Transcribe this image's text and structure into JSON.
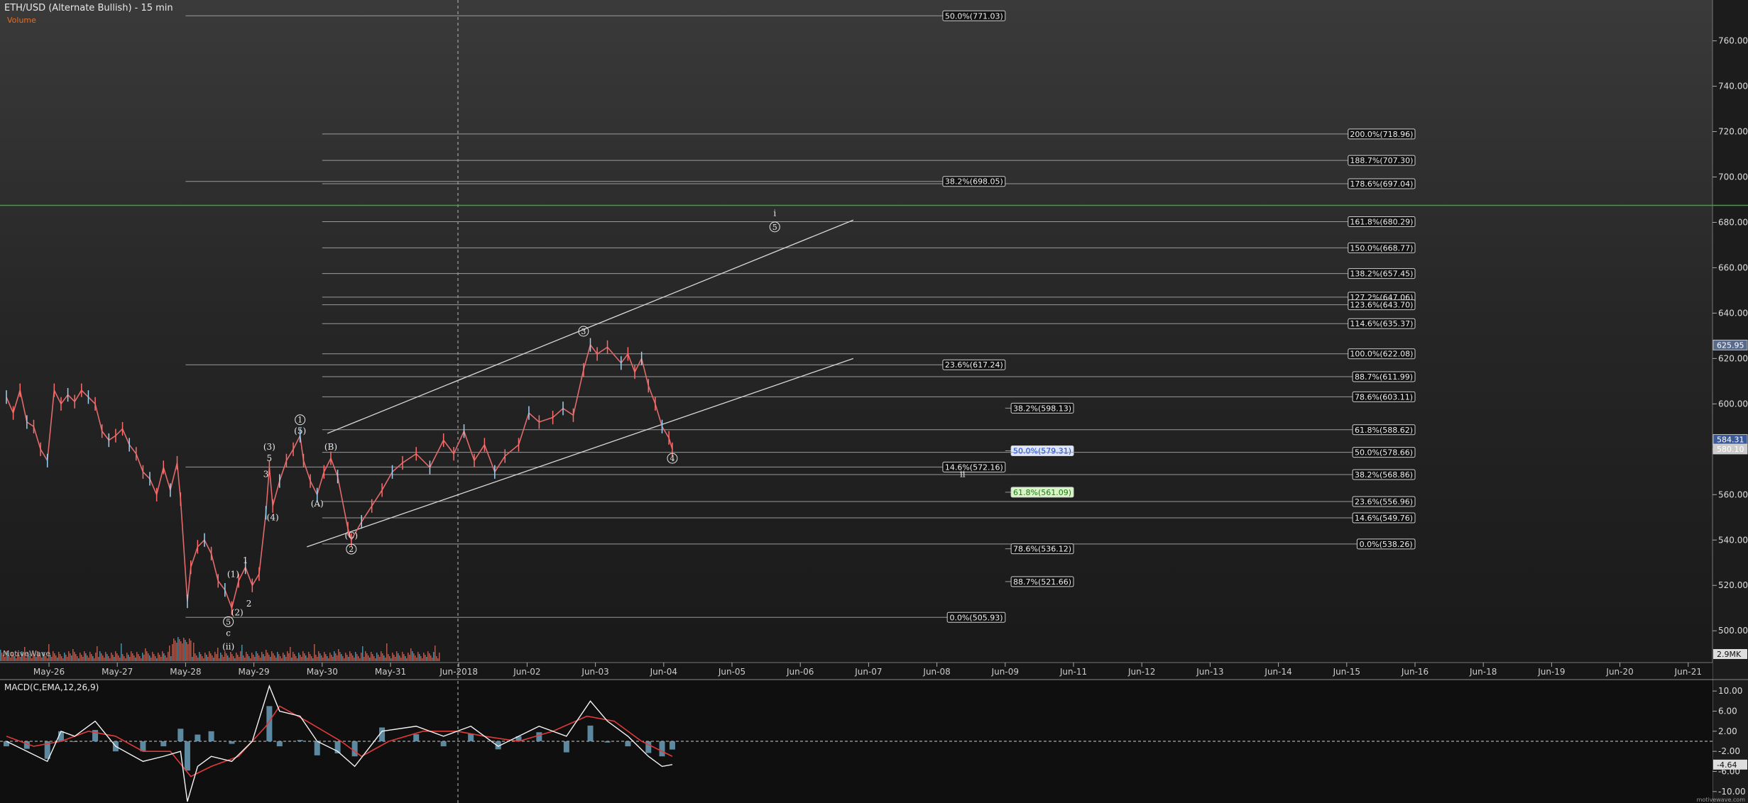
{
  "title": "ETH/USD (Alternate Bullish) - 15 min",
  "subtitle": "Volume",
  "watermark": "MotiveWave",
  "footer": "motivewave.com",
  "macd_label": "MACD(C,EMA,12,26,9)",
  "chart_data": {
    "type": "line",
    "price_axis": {
      "range": [
        486,
        778
      ],
      "ticks": [
        "760.00",
        "740.00",
        "720.00",
        "700.00",
        "680.00",
        "660.00",
        "640.00",
        "620.00",
        "600.00",
        "580.00",
        "560.00",
        "540.00",
        "520.00",
        "500.00"
      ]
    },
    "price_badges": [
      {
        "value": 625.95,
        "label": "625.95",
        "color": "#5a6a8a"
      },
      {
        "value": 584.31,
        "label": "584.31",
        "color": "#3a5a9a"
      },
      {
        "value": 580.1,
        "label": "580.10",
        "color": "#cccccc"
      }
    ],
    "volume_badge": "2.9MK",
    "date_axis": [
      "May-26",
      "May-27",
      "May-28",
      "May-29",
      "May-30",
      "May-31",
      "Jun-2018",
      "Jun-02",
      "Jun-03",
      "Jun-04",
      "Jun-05",
      "Jun-06",
      "Jun-07",
      "Jun-08",
      "Jun-09",
      "Jun-11",
      "Jun-12",
      "Jun-13",
      "Jun-14",
      "Jun-15",
      "Jun-16",
      "Jun-18",
      "Jun-19",
      "Jun-20",
      "Jun-21"
    ],
    "horizontal_line": {
      "value": 687.5,
      "color": "#2fae2f"
    },
    "fib_levels": [
      {
        "label": "50.0%(771.03)",
        "value": 771.03,
        "start_date": "May-28",
        "end_date": "Jun-09",
        "style": "plain"
      },
      {
        "label": "200.0%(718.96)",
        "value": 718.96,
        "start_date": "May-30",
        "end_date": "Jun-16",
        "style": "plain"
      },
      {
        "label": "188.7%(707.30)",
        "value": 707.3,
        "start_date": "May-30",
        "end_date": "Jun-16",
        "style": "plain"
      },
      {
        "label": "178.6%(697.04)",
        "value": 697.04,
        "start_date": "May-30",
        "end_date": "Jun-16",
        "style": "plain"
      },
      {
        "label": "38.2%(698.05)",
        "value": 698.05,
        "start_date": "May-28",
        "end_date": "Jun-09",
        "style": "plain"
      },
      {
        "label": "161.8%(680.29)",
        "value": 680.29,
        "start_date": "May-30",
        "end_date": "Jun-16",
        "style": "plain"
      },
      {
        "label": "150.0%(668.77)",
        "value": 668.77,
        "start_date": "May-30",
        "end_date": "Jun-16",
        "style": "plain"
      },
      {
        "label": "138.2%(657.45)",
        "value": 657.45,
        "start_date": "May-30",
        "end_date": "Jun-16",
        "style": "plain"
      },
      {
        "label": "127.2%(647.06)",
        "value": 647.06,
        "start_date": "May-30",
        "end_date": "Jun-16",
        "style": "plain"
      },
      {
        "label": "123.6%(643.70)",
        "value": 643.7,
        "start_date": "May-30",
        "end_date": "Jun-16",
        "style": "plain"
      },
      {
        "label": "114.6%(635.37)",
        "value": 635.37,
        "start_date": "May-30",
        "end_date": "Jun-16",
        "style": "plain"
      },
      {
        "label": "100.0%(622.08)",
        "value": 622.08,
        "start_date": "May-30",
        "end_date": "Jun-16",
        "style": "plain"
      },
      {
        "label": "23.6%(617.24)",
        "value": 617.24,
        "start_date": "May-28",
        "end_date": "Jun-09",
        "style": "plain"
      },
      {
        "label": "88.7%(611.99)",
        "value": 611.99,
        "start_date": "May-30",
        "end_date": "Jun-16",
        "style": "plain"
      },
      {
        "label": "78.6%(603.11)",
        "value": 603.11,
        "start_date": "May-30",
        "end_date": "Jun-16",
        "style": "plain"
      },
      {
        "label": "38.2%(598.13)",
        "value": 598.13,
        "start_date": "Jun-09",
        "end_date": "Jun-11",
        "style": "plain"
      },
      {
        "label": "61.8%(588.62)",
        "value": 588.62,
        "start_date": "May-30",
        "end_date": "Jun-16",
        "style": "plain"
      },
      {
        "label": "50.0%(579.31)",
        "value": 579.31,
        "start_date": "Jun-09",
        "end_date": "Jun-11",
        "style": "blue"
      },
      {
        "label": "50.0%(578.66)",
        "value": 578.66,
        "start_date": "May-30",
        "end_date": "Jun-16",
        "style": "plain"
      },
      {
        "label": "14.6%(572.16)",
        "value": 572.16,
        "start_date": "May-28",
        "end_date": "Jun-09",
        "style": "plain"
      },
      {
        "label": "38.2%(568.86)",
        "value": 568.86,
        "start_date": "May-30",
        "end_date": "Jun-16",
        "style": "plain"
      },
      {
        "label": "61.8%(561.09)",
        "value": 561.09,
        "start_date": "Jun-09",
        "end_date": "Jun-11",
        "style": "green"
      },
      {
        "label": "23.6%(556.96)",
        "value": 556.96,
        "start_date": "May-30",
        "end_date": "Jun-16",
        "style": "plain"
      },
      {
        "label": "14.6%(549.76)",
        "value": 549.76,
        "start_date": "May-30",
        "end_date": "Jun-16",
        "style": "plain"
      },
      {
        "label": "0.0%(538.26)",
        "value": 538.26,
        "start_date": "May-30",
        "end_date": "Jun-16",
        "style": "plain"
      },
      {
        "label": "78.6%(536.12)",
        "value": 536.12,
        "start_date": "Jun-09",
        "end_date": "Jun-11",
        "style": "plain"
      },
      {
        "label": "88.7%(521.66)",
        "value": 521.66,
        "start_date": "Jun-09",
        "end_date": "Jun-11",
        "style": "plain"
      },
      {
        "label": "0.0%(505.93)",
        "value": 505.93,
        "start_date": "May-28",
        "end_date": "Jun-09",
        "style": "plain"
      }
    ],
    "channel_lines": [
      {
        "from": {
          "date": 4.7,
          "value": 587
        },
        "to": {
          "date": 12.4,
          "value": 681
        }
      },
      {
        "from": {
          "date": 4.4,
          "value": 537
        },
        "to": {
          "date": 12.4,
          "value": 620
        }
      }
    ],
    "wave_labels": [
      {
        "text": "i",
        "date": 11.25,
        "value": 684
      },
      {
        "text": "5",
        "date": 11.25,
        "value": 678,
        "circled": true
      },
      {
        "text": "3",
        "date": 8.45,
        "value": 632,
        "circled": true
      },
      {
        "text": "4",
        "date": 9.75,
        "value": 576,
        "circled": true
      },
      {
        "text": "ii",
        "date": 14.0,
        "value": 569
      },
      {
        "text": "1",
        "date": 4.3,
        "value": 593,
        "circled": true
      },
      {
        "text": "(5)",
        "date": 4.3,
        "value": 588
      },
      {
        "text": "(3)",
        "date": 3.85,
        "value": 581
      },
      {
        "text": "5",
        "date": 3.85,
        "value": 576
      },
      {
        "text": "3",
        "date": 3.8,
        "value": 569
      },
      {
        "text": "(4)",
        "date": 3.9,
        "value": 550
      },
      {
        "text": "(B)",
        "date": 4.75,
        "value": 581
      },
      {
        "text": "(A)",
        "date": 4.55,
        "value": 556
      },
      {
        "text": "(C)",
        "date": 5.05,
        "value": 542
      },
      {
        "text": "2",
        "date": 5.05,
        "value": 536,
        "circled": true
      },
      {
        "text": "1",
        "date": 3.5,
        "value": 531
      },
      {
        "text": "(1)",
        "date": 3.32,
        "value": 525
      },
      {
        "text": "2",
        "date": 3.55,
        "value": 512
      },
      {
        "text": "(2)",
        "date": 3.38,
        "value": 508
      },
      {
        "text": "5",
        "date": 3.25,
        "value": 504,
        "circled": true
      },
      {
        "text": "c",
        "date": 3.25,
        "value": 499
      },
      {
        "text": "(ii)",
        "date": 3.25,
        "value": 493
      }
    ],
    "price_series": [
      {
        "date": 0.0,
        "value": 603
      },
      {
        "date": 0.1,
        "value": 596
      },
      {
        "date": 0.2,
        "value": 606
      },
      {
        "date": 0.3,
        "value": 592
      },
      {
        "date": 0.4,
        "value": 590
      },
      {
        "date": 0.5,
        "value": 580
      },
      {
        "date": 0.6,
        "value": 575
      },
      {
        "date": 0.7,
        "value": 606
      },
      {
        "date": 0.8,
        "value": 600
      },
      {
        "date": 0.9,
        "value": 604
      },
      {
        "date": 1.0,
        "value": 601
      },
      {
        "date": 1.1,
        "value": 606
      },
      {
        "date": 1.2,
        "value": 603
      },
      {
        "date": 1.3,
        "value": 600
      },
      {
        "date": 1.4,
        "value": 588
      },
      {
        "date": 1.5,
        "value": 584
      },
      {
        "date": 1.6,
        "value": 586
      },
      {
        "date": 1.7,
        "value": 589
      },
      {
        "date": 1.8,
        "value": 582
      },
      {
        "date": 1.9,
        "value": 578
      },
      {
        "date": 2.0,
        "value": 570
      },
      {
        "date": 2.1,
        "value": 567
      },
      {
        "date": 2.2,
        "value": 560
      },
      {
        "date": 2.3,
        "value": 572
      },
      {
        "date": 2.4,
        "value": 562
      },
      {
        "date": 2.5,
        "value": 574
      },
      {
        "date": 2.55,
        "value": 558
      },
      {
        "date": 2.65,
        "value": 513
      },
      {
        "date": 2.7,
        "value": 528
      },
      {
        "date": 2.8,
        "value": 537
      },
      {
        "date": 2.9,
        "value": 540
      },
      {
        "date": 3.0,
        "value": 534
      },
      {
        "date": 3.1,
        "value": 522
      },
      {
        "date": 3.2,
        "value": 518
      },
      {
        "date": 3.3,
        "value": 510
      },
      {
        "date": 3.4,
        "value": 522
      },
      {
        "date": 3.5,
        "value": 528
      },
      {
        "date": 3.6,
        "value": 520
      },
      {
        "date": 3.7,
        "value": 525
      },
      {
        "date": 3.8,
        "value": 552
      },
      {
        "date": 3.85,
        "value": 572
      },
      {
        "date": 3.9,
        "value": 555
      },
      {
        "date": 4.0,
        "value": 566
      },
      {
        "date": 4.1,
        "value": 575
      },
      {
        "date": 4.2,
        "value": 580
      },
      {
        "date": 4.3,
        "value": 586
      },
      {
        "date": 4.35,
        "value": 575
      },
      {
        "date": 4.45,
        "value": 566
      },
      {
        "date": 4.55,
        "value": 560
      },
      {
        "date": 4.65,
        "value": 570
      },
      {
        "date": 4.75,
        "value": 576
      },
      {
        "date": 4.85,
        "value": 568
      },
      {
        "date": 5.0,
        "value": 545
      },
      {
        "date": 5.05,
        "value": 540
      },
      {
        "date": 5.2,
        "value": 548
      },
      {
        "date": 5.35,
        "value": 555
      },
      {
        "date": 5.5,
        "value": 562
      },
      {
        "date": 5.65,
        "value": 570
      },
      {
        "date": 5.8,
        "value": 574
      },
      {
        "date": 6.0,
        "value": 578
      },
      {
        "date": 6.2,
        "value": 572
      },
      {
        "date": 6.4,
        "value": 584
      },
      {
        "date": 6.55,
        "value": 578
      },
      {
        "date": 6.7,
        "value": 588
      },
      {
        "date": 6.85,
        "value": 575
      },
      {
        "date": 7.0,
        "value": 582
      },
      {
        "date": 7.15,
        "value": 570
      },
      {
        "date": 7.3,
        "value": 577
      },
      {
        "date": 7.5,
        "value": 582
      },
      {
        "date": 7.65,
        "value": 596
      },
      {
        "date": 7.8,
        "value": 592
      },
      {
        "date": 8.0,
        "value": 594
      },
      {
        "date": 8.15,
        "value": 598
      },
      {
        "date": 8.3,
        "value": 595
      },
      {
        "date": 8.45,
        "value": 615
      },
      {
        "date": 8.55,
        "value": 626
      },
      {
        "date": 8.65,
        "value": 622
      },
      {
        "date": 8.8,
        "value": 625
      },
      {
        "date": 9.0,
        "value": 618
      },
      {
        "date": 9.1,
        "value": 622
      },
      {
        "date": 9.2,
        "value": 614
      },
      {
        "date": 9.3,
        "value": 620
      },
      {
        "date": 9.4,
        "value": 608
      },
      {
        "date": 9.5,
        "value": 600
      },
      {
        "date": 9.6,
        "value": 590
      },
      {
        "date": 9.7,
        "value": 585
      },
      {
        "date": 9.75,
        "value": 580
      }
    ],
    "volume_axis_max": "2.9MK",
    "macd": {
      "label": "MACD(C,EMA,12,26,9)",
      "range": [
        -12,
        12
      ],
      "ticks": [
        "10.00",
        "6.00",
        "2.00",
        "-2.00",
        "-6.00",
        "-10.00"
      ],
      "current_value": "-4.64",
      "zero_dashed": true,
      "macd_line": [
        {
          "date": 0.0,
          "value": 0
        },
        {
          "date": 0.3,
          "value": -2
        },
        {
          "date": 0.6,
          "value": -4
        },
        {
          "date": 0.8,
          "value": 2
        },
        {
          "date": 1.0,
          "value": 1
        },
        {
          "date": 1.3,
          "value": 4
        },
        {
          "date": 1.6,
          "value": -1
        },
        {
          "date": 2.0,
          "value": -4
        },
        {
          "date": 2.3,
          "value": -3
        },
        {
          "date": 2.55,
          "value": -2
        },
        {
          "date": 2.65,
          "value": -12
        },
        {
          "date": 2.8,
          "value": -5
        },
        {
          "date": 3.0,
          "value": -3
        },
        {
          "date": 3.3,
          "value": -4
        },
        {
          "date": 3.6,
          "value": 0
        },
        {
          "date": 3.85,
          "value": 11
        },
        {
          "date": 4.0,
          "value": 6
        },
        {
          "date": 4.3,
          "value": 5
        },
        {
          "date": 4.55,
          "value": 0
        },
        {
          "date": 4.85,
          "value": -2
        },
        {
          "date": 5.1,
          "value": -5
        },
        {
          "date": 5.5,
          "value": 2
        },
        {
          "date": 6.0,
          "value": 3
        },
        {
          "date": 6.4,
          "value": 1
        },
        {
          "date": 6.8,
          "value": 3
        },
        {
          "date": 7.2,
          "value": -1
        },
        {
          "date": 7.5,
          "value": 1
        },
        {
          "date": 7.8,
          "value": 3
        },
        {
          "date": 8.2,
          "value": 1
        },
        {
          "date": 8.55,
          "value": 8
        },
        {
          "date": 8.8,
          "value": 4
        },
        {
          "date": 9.1,
          "value": 1
        },
        {
          "date": 9.4,
          "value": -3
        },
        {
          "date": 9.6,
          "value": -5
        },
        {
          "date": 9.75,
          "value": -4.64
        }
      ],
      "signal_line": [
        {
          "date": 0.0,
          "value": 1
        },
        {
          "date": 0.4,
          "value": -1
        },
        {
          "date": 0.8,
          "value": 0
        },
        {
          "date": 1.2,
          "value": 2
        },
        {
          "date": 1.6,
          "value": 1
        },
        {
          "date": 2.0,
          "value": -2
        },
        {
          "date": 2.4,
          "value": -2
        },
        {
          "date": 2.7,
          "value": -7
        },
        {
          "date": 3.0,
          "value": -5
        },
        {
          "date": 3.4,
          "value": -3
        },
        {
          "date": 3.8,
          "value": 3
        },
        {
          "date": 4.0,
          "value": 7
        },
        {
          "date": 4.4,
          "value": 4
        },
        {
          "date": 4.9,
          "value": 0
        },
        {
          "date": 5.2,
          "value": -3
        },
        {
          "date": 5.6,
          "value": 0
        },
        {
          "date": 6.1,
          "value": 2
        },
        {
          "date": 6.6,
          "value": 2
        },
        {
          "date": 7.0,
          "value": 1
        },
        {
          "date": 7.5,
          "value": 0
        },
        {
          "date": 8.0,
          "value": 2
        },
        {
          "date": 8.5,
          "value": 5
        },
        {
          "date": 8.9,
          "value": 4
        },
        {
          "date": 9.3,
          "value": 0
        },
        {
          "date": 9.75,
          "value": -3
        }
      ]
    }
  }
}
